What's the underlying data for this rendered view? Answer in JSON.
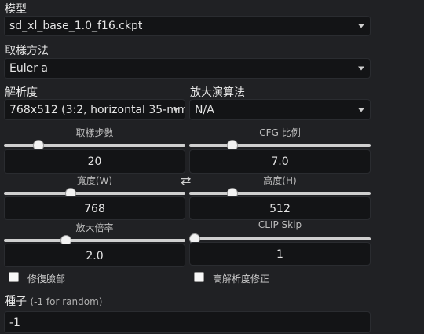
{
  "model": {
    "label": "模型",
    "value": "sd_xl_base_1.0_f16.ckpt"
  },
  "sampler": {
    "label": "取樣方法",
    "value": "Euler a"
  },
  "resolution": {
    "label": "解析度",
    "value": "768x512 (3:2, horizontal 35-mm"
  },
  "upscaler": {
    "label": "放大演算法",
    "value": "N/A"
  },
  "sliders": {
    "steps": {
      "label": "取樣步數",
      "value": "20",
      "fraction": 0.17
    },
    "cfg": {
      "label": "CFG 比例",
      "value": "7.0",
      "fraction": 0.22
    },
    "width": {
      "label": "寬度(W)",
      "value": "768",
      "fraction": 0.36
    },
    "height": {
      "label": "高度(H)",
      "value": "512",
      "fraction": 0.22
    },
    "scale": {
      "label": "放大倍率",
      "value": "2.0",
      "fraction": 0.33
    },
    "clip_skip": {
      "label": "CLIP Skip",
      "value": "1",
      "fraction": 0.0
    }
  },
  "swap_icon": "⇄",
  "checkboxes": {
    "face_restore": {
      "label": "修復臉部",
      "checked": false
    },
    "hires_fix": {
      "label": "高解析度修正",
      "checked": false
    }
  },
  "seed": {
    "label": "種子",
    "hint": "(-1 for random)",
    "value": "-1"
  }
}
